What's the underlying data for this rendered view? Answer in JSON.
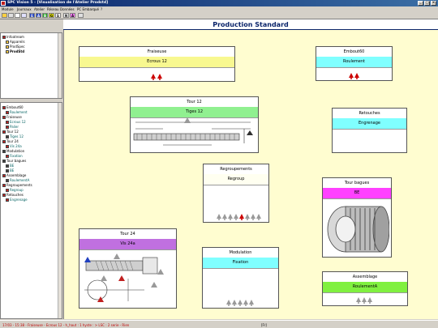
{
  "window": {
    "title": "SPC Vision 5 - [Visualisation de l'Atelier Prodstd]"
  },
  "menu": [
    "Module",
    "Journaux",
    "Atelier",
    "Réseau",
    "Données",
    "PC Embarqué",
    "?"
  ],
  "toolbar": {
    "letters": [
      "E",
      "A",
      "B",
      "G",
      "S",
      "N",
      "A"
    ]
  },
  "tree_top": {
    "root": "Infoatream",
    "items": [
      "Appareils",
      "ProdSpec",
      "ProdStd"
    ]
  },
  "tree_bottom": {
    "items": [
      "Embout60",
      "Roulement",
      "Fraiseuse",
      "Ecrous 12",
      "Palier",
      "Tour 12",
      "Tiges 12",
      "Tour 24",
      "Vis 24a",
      "Modulation",
      "Fixation",
      "Tour bagues",
      "BE",
      "BE",
      "Assemblage",
      "RoulementA",
      "Regroupements",
      "Regroup",
      "Retouches",
      "Engrenage"
    ]
  },
  "main": {
    "title": "Production Standard"
  },
  "machines": {
    "fraiseuse": {
      "name": "Fraiseuse",
      "product": "Ecrous 12",
      "color": "#f8f890"
    },
    "embout60": {
      "name": "Embout60",
      "product": "Roulement",
      "color": "#80ffff"
    },
    "tour12": {
      "name": "Tour 12",
      "product": "Tiges 12",
      "color": "#90f090"
    },
    "retouches": {
      "name": "Retouches",
      "product": "Engrenage",
      "color": "#80ffff"
    },
    "regroupements": {
      "name": "Regroupements",
      "product": "Regroup",
      "color": "#fffff0"
    },
    "tourbagues": {
      "name": "Tour bagues",
      "product": "BE",
      "color": "#ff40ff"
    },
    "tour24": {
      "name": "Tour 24",
      "product": "Vis 24a",
      "color": "#c070e0"
    },
    "modulation": {
      "name": "Modulation",
      "product": "Fixation",
      "color": "#80ffff"
    },
    "assemblage": {
      "name": "Assemblage",
      "product": "RoulementA",
      "color": "#80f040"
    }
  },
  "status": {
    "left": "17/03 - 15:38 - Fraiseuse - Ecrous 12 - h_haut : 1 hyste : > LSC : 2 serie - Rien",
    "mid": "[Fr]"
  }
}
